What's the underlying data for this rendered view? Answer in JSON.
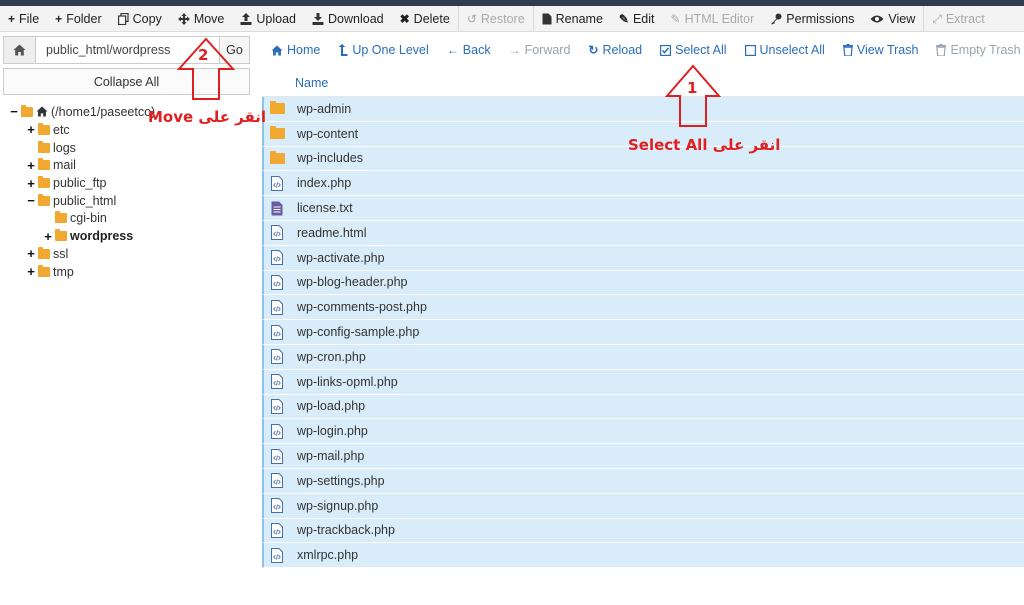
{
  "toolbar": {
    "items": [
      {
        "label": "File",
        "icon": "plus-icon",
        "disabled": false
      },
      {
        "label": "Folder",
        "icon": "plus-icon",
        "disabled": false
      },
      {
        "label": "Copy",
        "icon": "copy-icon",
        "disabled": false
      },
      {
        "label": "Move",
        "icon": "move-icon",
        "disabled": false
      },
      {
        "label": "Upload",
        "icon": "upload-icon",
        "disabled": false
      },
      {
        "label": "Download",
        "icon": "download-icon",
        "disabled": false
      },
      {
        "label": "Delete",
        "icon": "x-icon",
        "disabled": false
      },
      {
        "label": "Restore",
        "icon": "restore-icon",
        "disabled": true
      },
      {
        "label": "Rename",
        "icon": "file-icon",
        "disabled": false
      },
      {
        "label": "Edit",
        "icon": "pencil-icon",
        "disabled": false
      },
      {
        "label": "HTML Editor",
        "icon": "edit-box-icon",
        "disabled": true
      },
      {
        "label": "Permissions",
        "icon": "key-icon",
        "disabled": false
      },
      {
        "label": "View",
        "icon": "eye-icon",
        "disabled": false
      },
      {
        "label": "Extract",
        "icon": "expand-icon",
        "disabled": true
      }
    ]
  },
  "sidebar": {
    "path_value": "public_html/wordpress",
    "go_label": "Go",
    "collapse_label": "Collapse All",
    "tree": [
      {
        "label": "(/home1/paseetco)",
        "toggle": "−",
        "depth": 0,
        "bold": false,
        "home": true
      },
      {
        "label": "etc",
        "toggle": "+",
        "depth": 1,
        "bold": false
      },
      {
        "label": "logs",
        "toggle": "",
        "depth": 1,
        "bold": false
      },
      {
        "label": "mail",
        "toggle": "+",
        "depth": 1,
        "bold": false
      },
      {
        "label": "public_ftp",
        "toggle": "+",
        "depth": 1,
        "bold": false
      },
      {
        "label": "public_html",
        "toggle": "−",
        "depth": 1,
        "bold": false
      },
      {
        "label": "cgi-bin",
        "toggle": "",
        "depth": 2,
        "bold": false
      },
      {
        "label": "wordpress",
        "toggle": "+",
        "depth": 2,
        "bold": true
      },
      {
        "label": "ssl",
        "toggle": "+",
        "depth": 1,
        "bold": false
      },
      {
        "label": "tmp",
        "toggle": "+",
        "depth": 1,
        "bold": false
      }
    ]
  },
  "navbar": {
    "items": [
      {
        "label": "Home",
        "icon": "home-icon",
        "disabled": false
      },
      {
        "label": "Up One Level",
        "icon": "level-up-icon",
        "disabled": false
      },
      {
        "label": "Back",
        "icon": "arrow-left-icon",
        "disabled": false
      },
      {
        "label": "Forward",
        "icon": "arrow-right-icon",
        "disabled": true
      },
      {
        "label": "Reload",
        "icon": "reload-icon",
        "disabled": false
      },
      {
        "label": "Select All",
        "icon": "checkbox-checked-icon",
        "disabled": false
      },
      {
        "label": "Unselect All",
        "icon": "checkbox-empty-icon",
        "disabled": false
      },
      {
        "label": "View Trash",
        "icon": "trash-icon",
        "disabled": false
      },
      {
        "label": "Empty Trash",
        "icon": "trash-icon",
        "disabled": true
      }
    ]
  },
  "table": {
    "header_name": "Name",
    "files": [
      {
        "name": "wp-admin",
        "type": "folder"
      },
      {
        "name": "wp-content",
        "type": "folder"
      },
      {
        "name": "wp-includes",
        "type": "folder"
      },
      {
        "name": "index.php",
        "type": "code"
      },
      {
        "name": "license.txt",
        "type": "text"
      },
      {
        "name": "readme.html",
        "type": "code"
      },
      {
        "name": "wp-activate.php",
        "type": "code"
      },
      {
        "name": "wp-blog-header.php",
        "type": "code"
      },
      {
        "name": "wp-comments-post.php",
        "type": "code"
      },
      {
        "name": "wp-config-sample.php",
        "type": "code"
      },
      {
        "name": "wp-cron.php",
        "type": "code"
      },
      {
        "name": "wp-links-opml.php",
        "type": "code"
      },
      {
        "name": "wp-load.php",
        "type": "code"
      },
      {
        "name": "wp-login.php",
        "type": "code"
      },
      {
        "name": "wp-mail.php",
        "type": "code"
      },
      {
        "name": "wp-settings.php",
        "type": "code"
      },
      {
        "name": "wp-signup.php",
        "type": "code"
      },
      {
        "name": "wp-trackback.php",
        "type": "code"
      },
      {
        "name": "xmlrpc.php",
        "type": "code"
      }
    ]
  },
  "annotations": {
    "step2_number": "2",
    "step2_text": "انقر على Move",
    "step1_number": "1",
    "step1_text": "انقر على Select All"
  },
  "colors": {
    "selected_row": "#d9ecf9",
    "link_blue": "#2a6ebb",
    "annotation_red": "#e02020",
    "folder": "#f0a830"
  }
}
